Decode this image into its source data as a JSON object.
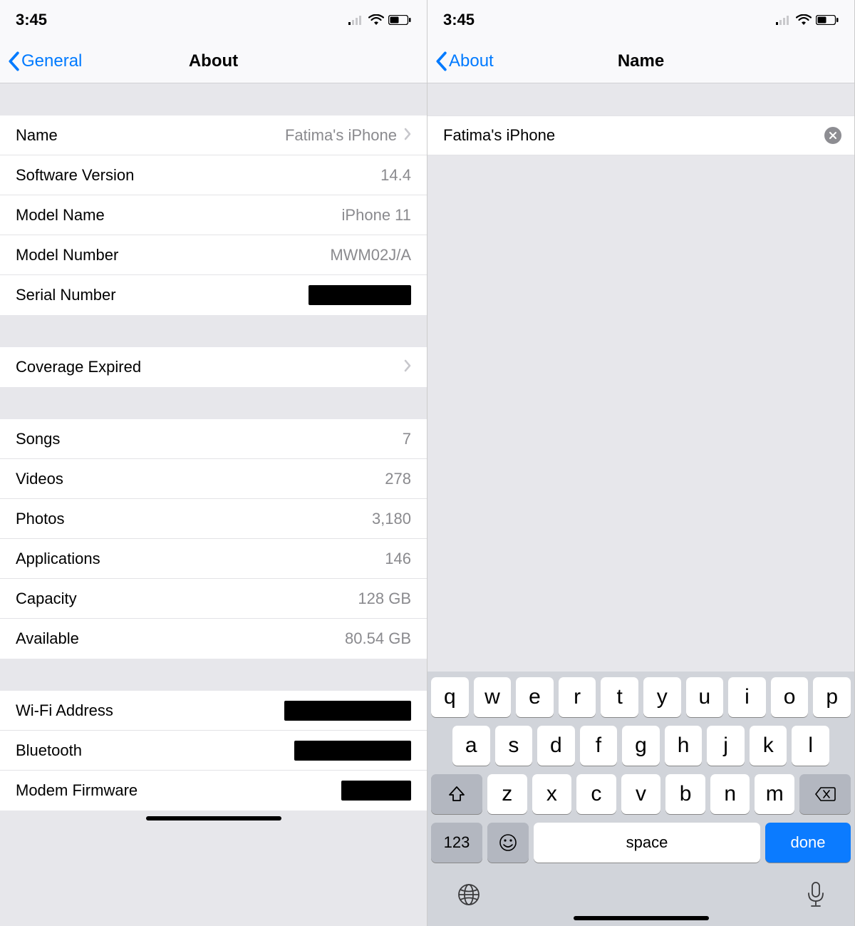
{
  "status": {
    "time": "3:45"
  },
  "left": {
    "nav": {
      "back": "General",
      "title": "About"
    },
    "group1": [
      {
        "label": "Name",
        "value": "Fatima's iPhone",
        "chevron": true
      },
      {
        "label": "Software Version",
        "value": "14.4"
      },
      {
        "label": "Model Name",
        "value": "iPhone 11"
      },
      {
        "label": "Model Number",
        "value": "MWM02J/A"
      },
      {
        "label": "Serial Number",
        "redacted": "sn"
      }
    ],
    "group2": [
      {
        "label": "Coverage Expired",
        "chevron": true
      }
    ],
    "group3": [
      {
        "label": "Songs",
        "value": "7"
      },
      {
        "label": "Videos",
        "value": "278"
      },
      {
        "label": "Photos",
        "value": "3,180"
      },
      {
        "label": "Applications",
        "value": "146"
      },
      {
        "label": "Capacity",
        "value": "128 GB"
      },
      {
        "label": "Available",
        "value": "80.54 GB"
      }
    ],
    "group4": [
      {
        "label": "Wi-Fi Address",
        "redacted": "wifi"
      },
      {
        "label": "Bluetooth",
        "redacted": "bt"
      },
      {
        "label": "Modem Firmware",
        "redacted": "mf"
      }
    ]
  },
  "right": {
    "nav": {
      "back": "About",
      "title": "Name"
    },
    "input_value": "Fatima's iPhone",
    "keyboard": {
      "r1": [
        "q",
        "w",
        "e",
        "r",
        "t",
        "y",
        "u",
        "i",
        "o",
        "p"
      ],
      "r2": [
        "a",
        "s",
        "d",
        "f",
        "g",
        "h",
        "j",
        "k",
        "l"
      ],
      "r3": [
        "z",
        "x",
        "c",
        "v",
        "b",
        "n",
        "m"
      ],
      "num_key": "123",
      "space": "space",
      "done": "done"
    }
  }
}
